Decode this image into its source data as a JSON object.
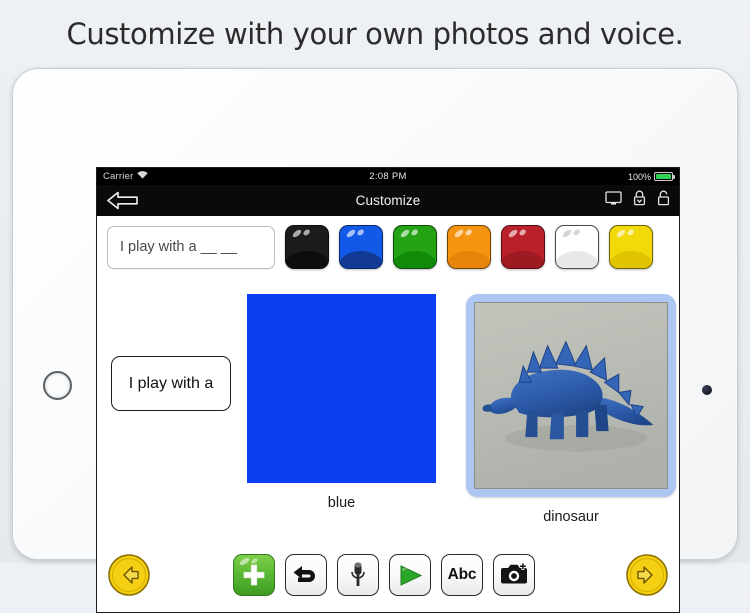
{
  "headline": "Customize with your own photos and voice.",
  "device": {
    "name": "ipad-frame",
    "home_button": "home-button",
    "camera": "front-camera"
  },
  "status_bar": {
    "carrier": "Carrier",
    "wifi_icon": "wifi-icon",
    "time": "2:08 PM",
    "battery_percent": "100%",
    "battery_icon": "battery-full-icon"
  },
  "nav_bar": {
    "back_icon": "back-arrow-icon",
    "title": "Customize",
    "actions": [
      {
        "name": "display-mirror-icon",
        "label": "display"
      },
      {
        "name": "lock-closed-dropdown-icon",
        "label": "lock-settings"
      },
      {
        "name": "lock-open-icon",
        "label": "unlock"
      }
    ]
  },
  "sentence_strip": {
    "value": "I play with a __ __",
    "placeholder": "I play with a __ __"
  },
  "palette": {
    "colors": [
      {
        "name": "black",
        "hex": "#1b1b1b",
        "wave_hex": "#0d0d0d"
      },
      {
        "name": "blue",
        "hex": "#1359e8",
        "wave_hex": "#123a94",
        "selected": true
      },
      {
        "name": "green",
        "hex": "#23a314",
        "wave_hex": "#118a0a"
      },
      {
        "name": "orange",
        "hex": "#f59410",
        "wave_hex": "#e8840a"
      },
      {
        "name": "red",
        "hex": "#b9202a",
        "wave_hex": "#9d1a22"
      },
      {
        "name": "white",
        "hex": "#ffffff",
        "wave_hex": "#e8e8e8"
      },
      {
        "name": "yellow",
        "hex": "#f2d90a",
        "wave_hex": "#e0c400"
      }
    ]
  },
  "content": {
    "strip_word": "I play with a",
    "color_card": {
      "label": "blue",
      "swatch_hex": "#0a3ff1"
    },
    "photo_card": {
      "label": "dinosaur",
      "frame_hex": "#aec6f2",
      "photo_alt": "blue-stegosaurus-toy",
      "background_hex": "#b9bcb4",
      "subject_hex": "#2f5fae"
    }
  },
  "toolbar": {
    "prev_label": "previous-page",
    "next_label": "next-page",
    "buttons": [
      {
        "name": "add-button",
        "icon": "plus-icon",
        "label": "Add"
      },
      {
        "name": "undo-button",
        "icon": "undo-arrow-icon",
        "label": "Undo"
      },
      {
        "name": "record-button",
        "icon": "microphone-icon",
        "label": "Record"
      },
      {
        "name": "play-button",
        "icon": "play-triangle-icon",
        "label": "Play"
      },
      {
        "name": "text-button",
        "icon": "abc-icon",
        "label": "Abc"
      },
      {
        "name": "camera-button",
        "icon": "camera-plus-icon",
        "label": "Camera"
      }
    ]
  }
}
